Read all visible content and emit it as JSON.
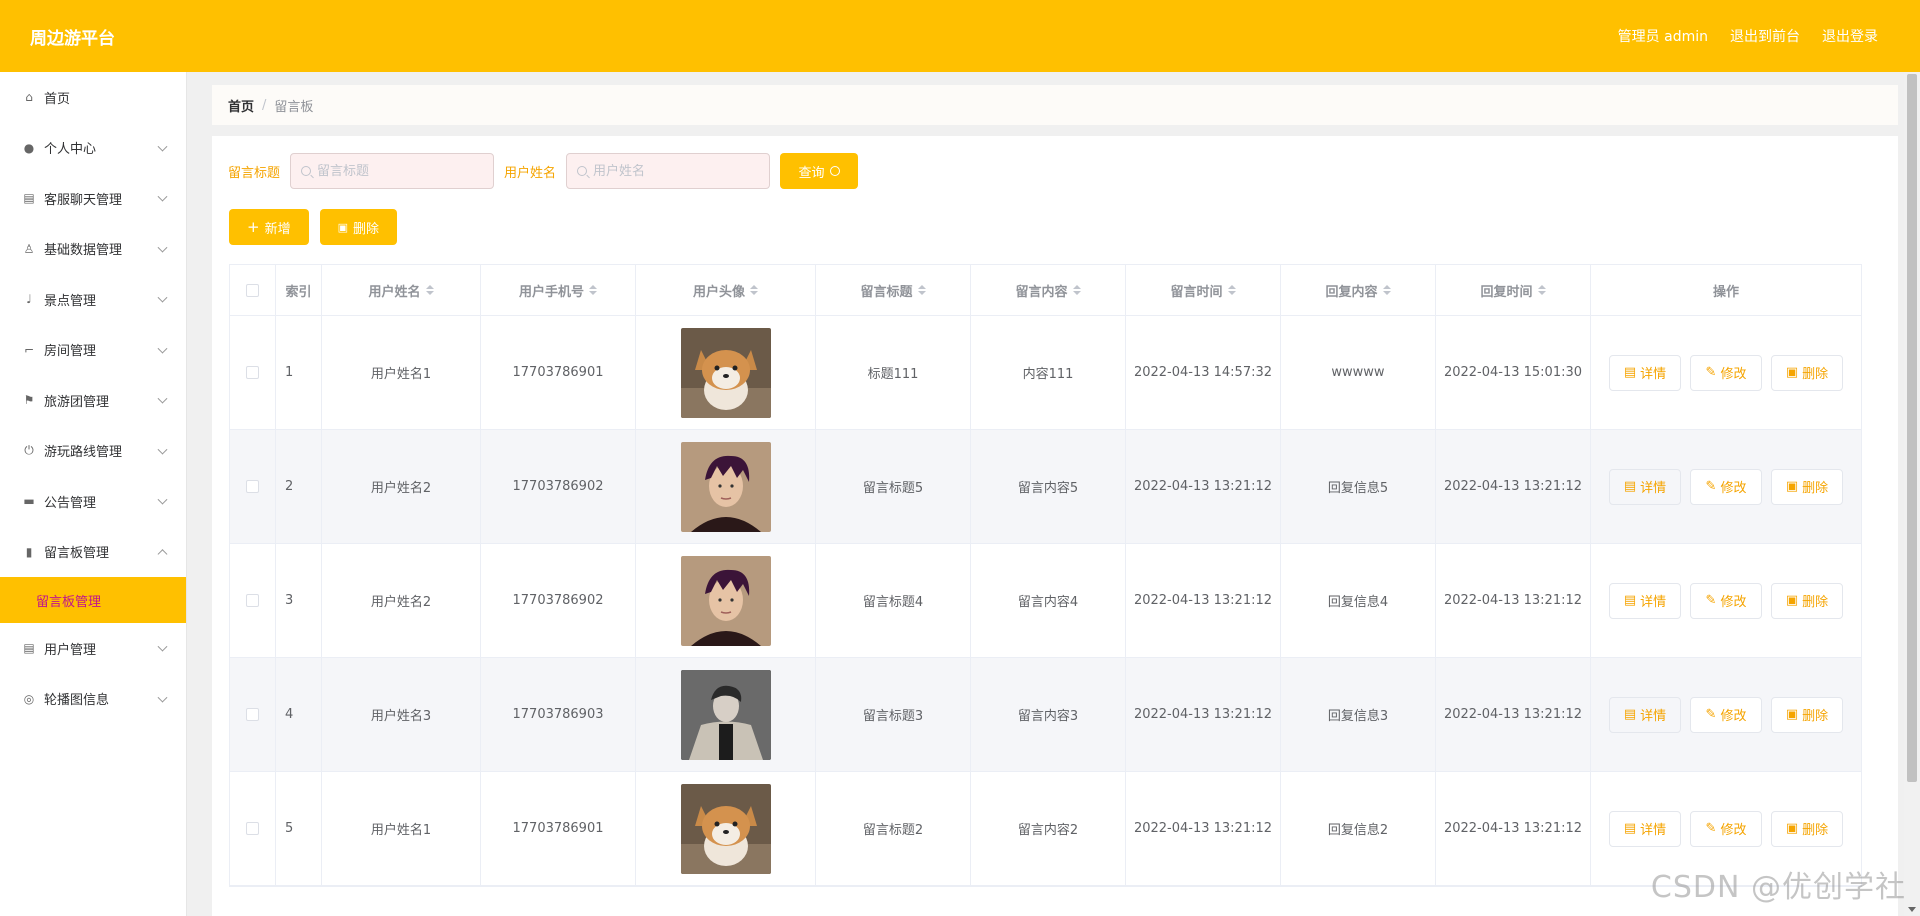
{
  "header": {
    "brand": "周边游平台",
    "admin_label": "管理员 admin",
    "front_label": "退出到前台",
    "logout_label": "退出登录"
  },
  "sidebar": {
    "items": [
      {
        "label": "首页",
        "icon": "home-icon",
        "expandable": false
      },
      {
        "label": "个人中心",
        "icon": "user-icon",
        "expandable": true
      },
      {
        "label": "客服聊天管理",
        "icon": "clipboard-icon",
        "expandable": true
      },
      {
        "label": "基础数据管理",
        "icon": "person-stamp-icon",
        "expandable": true
      },
      {
        "label": "景点管理",
        "icon": "microphone-icon",
        "expandable": true
      },
      {
        "label": "房间管理",
        "icon": "crop-icon",
        "expandable": true
      },
      {
        "label": "旅游团管理",
        "icon": "flag-icon",
        "expandable": true
      },
      {
        "label": "游玩路线管理",
        "icon": "power-icon",
        "expandable": true
      },
      {
        "label": "公告管理",
        "icon": "briefcase-icon",
        "expandable": true
      },
      {
        "label": "留言板管理",
        "icon": "ticket-icon",
        "expandable": true,
        "open": true
      }
    ],
    "submenu": {
      "label": "留言板管理"
    },
    "items_after": [
      {
        "label": "用户管理",
        "icon": "clipboard-icon",
        "expandable": true
      },
      {
        "label": "轮播图信息",
        "icon": "compass-icon",
        "expandable": true
      }
    ]
  },
  "breadcrumb": {
    "home": "首页",
    "sep": "/",
    "current": "留言板"
  },
  "search": {
    "title_label": "留言标题",
    "title_placeholder": "留言标题",
    "name_label": "用户姓名",
    "name_placeholder": "用户姓名",
    "query_label": "查询"
  },
  "actions": {
    "add_label": "新增",
    "delete_label": "删除"
  },
  "table": {
    "columns": [
      "索引",
      "用户姓名",
      "用户手机号",
      "用户头像",
      "留言标题",
      "留言内容",
      "留言时间",
      "回复内容",
      "回复时间",
      "操作"
    ],
    "rows": [
      {
        "index": "1",
        "name": "用户姓名1",
        "phone": "17703786901",
        "avatar": "shiba-dog",
        "title": "标题111",
        "content": "内容111",
        "time": "2022-04-13 14:57:32",
        "reply": "wwwww",
        "reply_time": "2022-04-13 15:01:30"
      },
      {
        "index": "2",
        "name": "用户姓名2",
        "phone": "17703786902",
        "avatar": "man-purple-hair",
        "title": "留言标题5",
        "content": "留言内容5",
        "time": "2022-04-13 13:21:12",
        "reply": "回复信息5",
        "reply_time": "2022-04-13 13:21:12"
      },
      {
        "index": "3",
        "name": "用户姓名2",
        "phone": "17703786902",
        "avatar": "man-purple-hair",
        "title": "留言标题4",
        "content": "留言内容4",
        "time": "2022-04-13 13:21:12",
        "reply": "回复信息4",
        "reply_time": "2022-04-13 13:21:12"
      },
      {
        "index": "4",
        "name": "用户姓名3",
        "phone": "17703786903",
        "avatar": "man-trench-coat",
        "title": "留言标题3",
        "content": "留言内容3",
        "time": "2022-04-13 13:21:12",
        "reply": "回复信息3",
        "reply_time": "2022-04-13 13:21:12"
      },
      {
        "index": "5",
        "name": "用户姓名1",
        "phone": "17703786901",
        "avatar": "shiba-dog",
        "title": "留言标题2",
        "content": "留言内容2",
        "time": "2022-04-13 13:21:12",
        "reply": "回复信息2",
        "reply_time": "2022-04-13 13:21:12"
      }
    ],
    "op_detail": "详情",
    "op_edit": "修改",
    "op_delete": "删除"
  },
  "watermark": "CSDN @优创学社",
  "colors": {
    "accent": "#ffc000",
    "active_submenu_text": "#c0158c",
    "label_orange": "#f5a400"
  }
}
